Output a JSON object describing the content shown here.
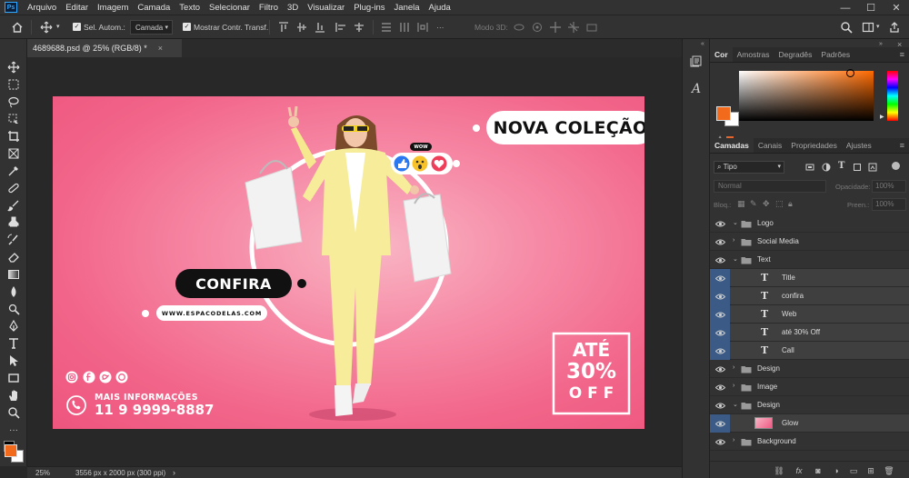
{
  "app": {
    "name": "Ps"
  },
  "menu": [
    "Arquivo",
    "Editar",
    "Imagem",
    "Camada",
    "Texto",
    "Selecionar",
    "Filtro",
    "3D",
    "Visualizar",
    "Plug-ins",
    "Janela",
    "Ajuda"
  ],
  "window_controls": {
    "minimize": "—",
    "maximize": "☐",
    "close": "✕"
  },
  "options_bar": {
    "auto_select_label": "Sel. Autom.:",
    "auto_select_target": "Camada",
    "show_transform_label": "Mostrar Contr. Transf.",
    "mode_3d_label": "Modo 3D:"
  },
  "document_tab": {
    "title": "4689688.psd @ 25% (RGB/8) *",
    "close": "×"
  },
  "status_bar": {
    "zoom": "25%",
    "doc_info": "3556 px x 2000 px (300 ppi)",
    "arrow": "›"
  },
  "artwork": {
    "headline": "NOVA COLEÇÃO",
    "cta": "CONFIRA",
    "website": "WWW.ESPACODELAS.COM",
    "discount_line1": "ATÉ",
    "discount_line2": "30%",
    "discount_line3": "O F F",
    "info_label": "MAIS INFORMAÇÕES",
    "phone": "11 9 9999-8887",
    "reaction_label": "WOW"
  },
  "color_panel": {
    "tabs": [
      "Cor",
      "Amostras",
      "Degradês",
      "Padrões"
    ],
    "active_tab": "Cor",
    "foreground": "#f26a1b",
    "background": "#ffffff",
    "gamut_warning_color": "#e2662e"
  },
  "layers_panel": {
    "tabs": [
      "Camadas",
      "Canais",
      "Propriedades",
      "Ajustes"
    ],
    "active_tab": "Camadas",
    "filter_kind": "Tipo",
    "blend_mode": "Normal",
    "opacity_label": "Opacidade:",
    "opacity_value": "100%",
    "lock_label": "Bloq.:",
    "fill_label": "Preen.:",
    "fill_value": "100%",
    "layers": [
      {
        "name": "Logo",
        "type": "group",
        "expanded": true,
        "indent": 0,
        "visible": true,
        "highlight": false
      },
      {
        "name": "Social Media",
        "type": "group",
        "expanded": false,
        "indent": 0,
        "visible": true,
        "highlight": false
      },
      {
        "name": "Text",
        "type": "group",
        "expanded": true,
        "indent": 0,
        "visible": true,
        "highlight": false
      },
      {
        "name": "Title",
        "type": "text",
        "indent": 1,
        "visible": true,
        "highlight": true
      },
      {
        "name": "confira",
        "type": "text",
        "indent": 1,
        "visible": true,
        "highlight": true
      },
      {
        "name": "Web",
        "type": "text",
        "indent": 1,
        "visible": true,
        "highlight": true
      },
      {
        "name": "até 30% Off",
        "type": "text",
        "indent": 1,
        "visible": true,
        "highlight": true
      },
      {
        "name": "Call",
        "type": "text",
        "indent": 1,
        "visible": true,
        "highlight": true
      },
      {
        "name": "Design",
        "type": "group",
        "expanded": false,
        "indent": 0,
        "visible": true,
        "highlight": false
      },
      {
        "name": "Image",
        "type": "group",
        "expanded": false,
        "indent": 0,
        "visible": true,
        "highlight": false
      },
      {
        "name": "Design",
        "type": "group",
        "expanded": true,
        "indent": 0,
        "visible": true,
        "highlight": false
      },
      {
        "name": "Glow",
        "type": "image",
        "indent": 1,
        "visible": true,
        "highlight": true
      },
      {
        "name": "Background",
        "type": "group",
        "expanded": false,
        "indent": 0,
        "visible": true,
        "highlight": false
      }
    ],
    "bottom_icons": [
      "link-icon",
      "fx-icon",
      "mask-icon",
      "adjustment-icon",
      "folder-icon",
      "new-layer-icon",
      "trash-icon"
    ]
  }
}
